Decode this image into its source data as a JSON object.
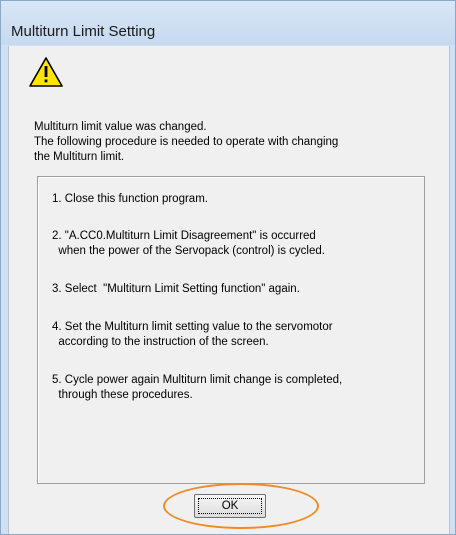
{
  "window": {
    "title": "Multiturn Limit Setting"
  },
  "dialog": {
    "icon": "warning-icon",
    "message_lines": [
      "Multiturn limit value was changed.",
      "The following procedure is needed to operate with changing",
      "the Multiturn limit."
    ],
    "steps": [
      {
        "lines": [
          "1. Close this function program."
        ]
      },
      {
        "lines": [
          "2. \"A.CC0.Multiturn Limit Disagreement\" is occurred",
          "  when the power of the Servopack (control) is cycled."
        ]
      },
      {
        "lines": [
          "3. Select  \"Multiturn Limit Setting function\" again."
        ]
      },
      {
        "lines": [
          "4. Set the Multiturn limit setting value to the servomotor",
          "  according to the instruction of the screen."
        ]
      },
      {
        "lines": [
          "5. Cycle power again Multiturn limit change is completed,",
          "  through these procedures."
        ]
      }
    ],
    "ok_label": "OK"
  },
  "colors": {
    "highlight": "#f08a24",
    "warning_fill": "#ffe600"
  }
}
